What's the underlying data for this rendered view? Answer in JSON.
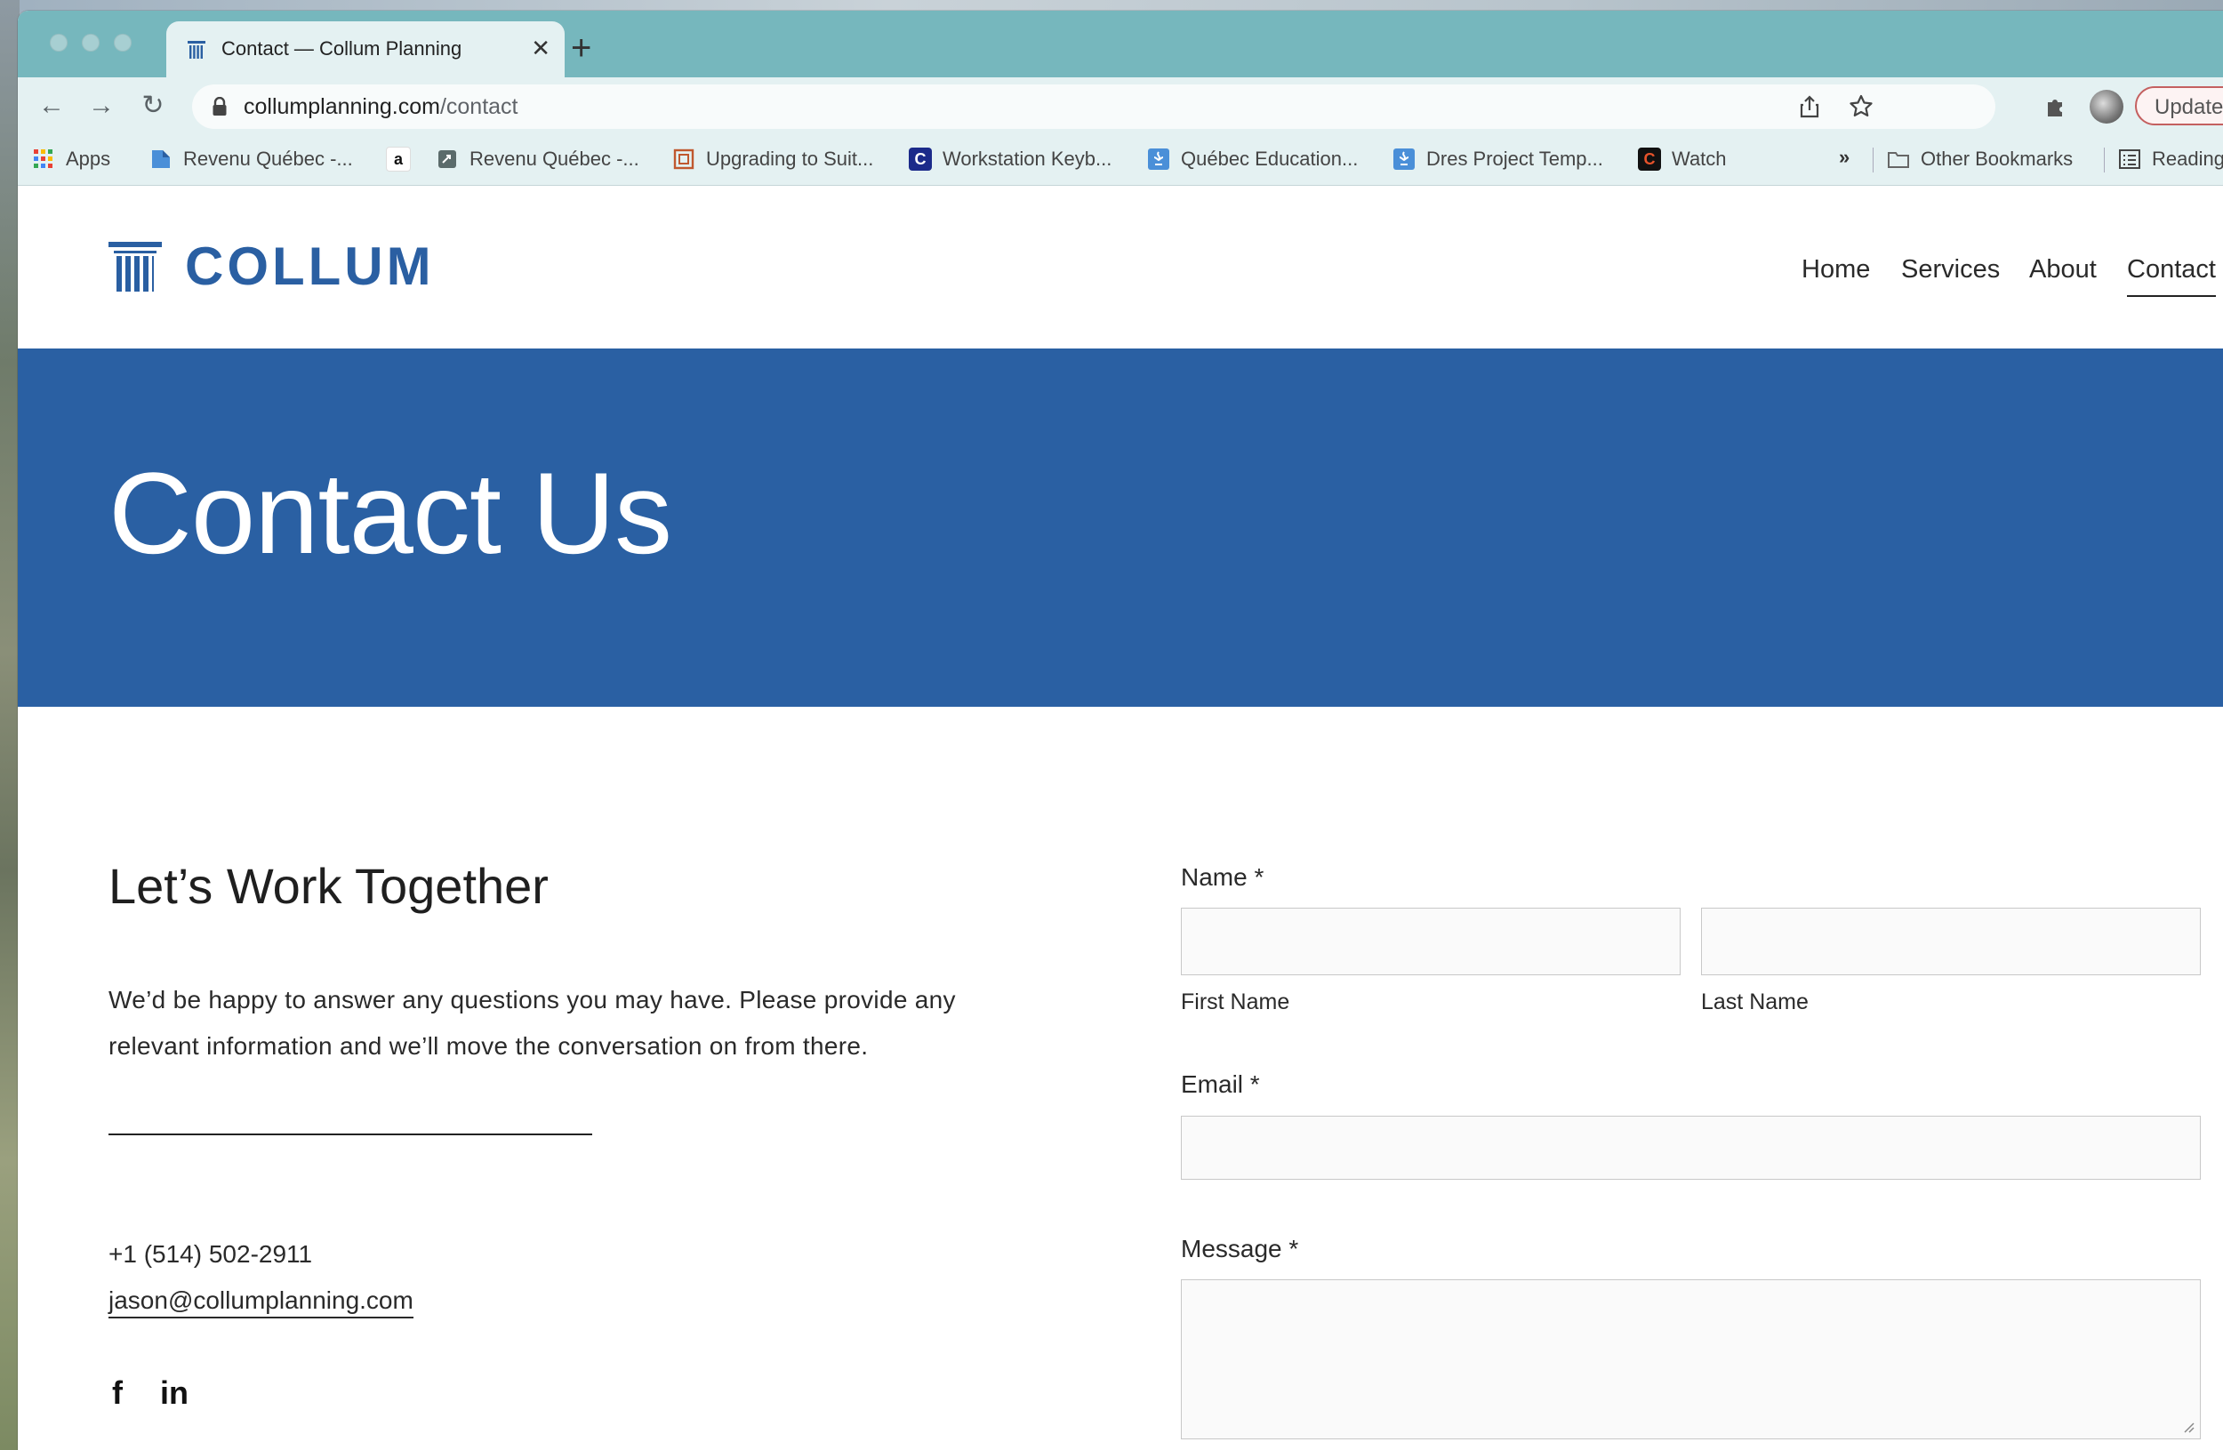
{
  "browser": {
    "tab_title": "Contact — Collum Planning",
    "tab_close": "✕",
    "new_tab": "+",
    "url_host": "collumplanning.com",
    "url_path": "/contact",
    "update_label": "Update",
    "nav_back": "←",
    "nav_forward": "→",
    "nav_reload": "↻"
  },
  "bookmarks": {
    "items": [
      {
        "label": "Apps",
        "icon": "apps-grid-icon"
      },
      {
        "label": "Revenu Québec -...",
        "icon": "revenu-quebec-icon"
      },
      {
        "label": "",
        "icon": "amazon-icon"
      },
      {
        "label": "Revenu Québec -...",
        "icon": "revenu-quebec-doc-icon"
      },
      {
        "label": "Upgrading to Suit...",
        "icon": "suite-icon"
      },
      {
        "label": "Workstation Keyb...",
        "icon": "workstation-icon"
      },
      {
        "label": "Québec Education...",
        "icon": "quebec-fleur-icon"
      },
      {
        "label": "Dres Project Temp...",
        "icon": "quebec-fleur-icon"
      },
      {
        "label": "Watch",
        "icon": "watch-c-icon"
      }
    ],
    "overflow": "»",
    "other": "Other Bookmarks",
    "reading": "Reading"
  },
  "site": {
    "logo_text": "COLLUM",
    "nav": [
      "Home",
      "Services",
      "About",
      "Contact"
    ],
    "active_nav": "Contact",
    "hero_title": "Contact Us",
    "heading": "Let’s Work Together",
    "paragraph": "We’d be happy to answer any questions you may have. Please provide any relevant information and we’ll move the conversation on from there.",
    "phone": "+1 (514) 502-2911",
    "email": "jason@collumplanning.com",
    "social": [
      "f",
      "in"
    ],
    "brand_color": "#2a60a3"
  },
  "form": {
    "name_label": "Name *",
    "first_name_label": "First Name",
    "last_name_label": "Last Name",
    "email_label": "Email *",
    "message_label": "Message *",
    "first_name_value": "",
    "last_name_value": "",
    "email_value": "",
    "message_value": ""
  }
}
